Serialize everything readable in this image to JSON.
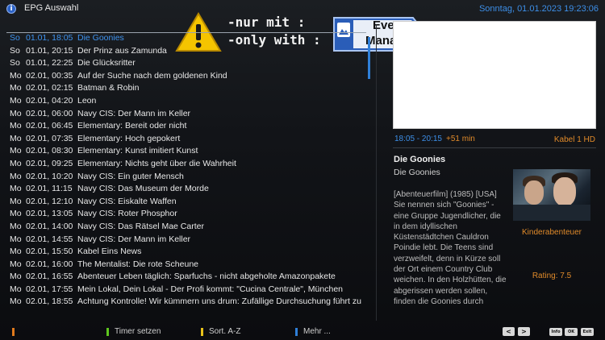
{
  "header": {
    "info_glyph": "i",
    "title": "EPG Auswahl",
    "datetime": "Sonntag, 01.01.2023   19:23:06"
  },
  "overlay": {
    "line1": "-nur mit :",
    "line2": "-only with :",
    "badge_line1": "Event",
    "badge_line2": "Manager",
    "warning_glyph": "!"
  },
  "epg_list": [
    {
      "day": "So",
      "datetime": "01.01, 18:05",
      "title": "Die Goonies"
    },
    {
      "day": "So",
      "datetime": "01.01, 20:15",
      "title": "Der Prinz aus Zamunda"
    },
    {
      "day": "So",
      "datetime": "01.01, 22:25",
      "title": "Die Glücksritter"
    },
    {
      "day": "Mo",
      "datetime": "02.01, 00:35",
      "title": "Auf der Suche nach dem goldenen Kind"
    },
    {
      "day": "Mo",
      "datetime": "02.01, 02:15",
      "title": "Batman & Robin"
    },
    {
      "day": "Mo",
      "datetime": "02.01, 04:20",
      "title": "Leon"
    },
    {
      "day": "Mo",
      "datetime": "02.01, 06:00",
      "title": "Navy CIS: Der Mann im Keller"
    },
    {
      "day": "Mo",
      "datetime": "02.01, 06:45",
      "title": "Elementary: Bereit oder nicht"
    },
    {
      "day": "Mo",
      "datetime": "02.01, 07:35",
      "title": "Elementary: Hoch gepokert"
    },
    {
      "day": "Mo",
      "datetime": "02.01, 08:30",
      "title": "Elementary: Kunst imitiert Kunst"
    },
    {
      "day": "Mo",
      "datetime": "02.01, 09:25",
      "title": "Elementary: Nichts geht über die Wahrheit"
    },
    {
      "day": "Mo",
      "datetime": "02.01, 10:20",
      "title": "Navy CIS: Ein guter Mensch"
    },
    {
      "day": "Mo",
      "datetime": "02.01, 11:15",
      "title": "Navy CIS: Das Museum der Morde"
    },
    {
      "day": "Mo",
      "datetime": "02.01, 12:10",
      "title": "Navy CIS: Eiskalte Waffen"
    },
    {
      "day": "Mo",
      "datetime": "02.01, 13:05",
      "title": "Navy CIS: Roter Phosphor"
    },
    {
      "day": "Mo",
      "datetime": "02.01, 14:00",
      "title": "Navy CIS: Das Rätsel Mae Carter"
    },
    {
      "day": "Mo",
      "datetime": "02.01, 14:55",
      "title": "Navy CIS: Der Mann im Keller"
    },
    {
      "day": "Mo",
      "datetime": "02.01, 15:50",
      "title": "Kabel Eins News"
    },
    {
      "day": "Mo",
      "datetime": "02.01, 16:00",
      "title": "The Mentalist: Die rote Scheune"
    },
    {
      "day": "Mo",
      "datetime": "02.01, 16:55",
      "title": "Abenteuer Leben täglich: Sparfuchs - nicht abgeholte Amazonpakete"
    },
    {
      "day": "Mo",
      "datetime": "02.01, 17:55",
      "title": "Mein Lokal, Dein Lokal - Der Profi kommt: \"Cucina Centrale\", München"
    },
    {
      "day": "Mo",
      "datetime": "02.01, 18:55",
      "title": "Achtung Kontrolle! Wir kümmern uns drum: Zufällige Durchsuchung führt zu"
    }
  ],
  "detail": {
    "time_range": "18:05 - 20:15",
    "delta": "+51 min",
    "channel": "Kabel 1 HD",
    "title": "Die Goonies",
    "subtitle": "Die Goonies",
    "genre": "Kinderabenteuer",
    "rating": "Rating: 7.5",
    "description": "[Abenteuerfilm]  (1985) [USA] Sie nennen sich \"Goonies\" - eine Gruppe Jugendlicher, die in dem idyllischen Küstenstädtchen Cauldron Poindie lebt. Die Teens sind verzweifelt, denn in Kürze soll der Ort einem Country Club weichen. In den Holzhütten, die abgerissen werden sollen, finden die Goonies durch"
  },
  "footer": {
    "red_label": "",
    "green_label": "Timer setzen",
    "yellow_label": "Sort. A-Z",
    "blue_label": "Mehr ...",
    "prev_glyph": "<",
    "next_glyph": ">",
    "info_btn": "Info",
    "ok_btn": "OK",
    "exit_btn": "Exit",
    "colors": {
      "red": "#e07a1c",
      "green": "#5ec71e",
      "yellow": "#e8c21a",
      "blue": "#2f7fd8"
    }
  },
  "colors": {
    "accent_blue": "#3f93ee",
    "accent_orange": "#e08a2a"
  }
}
